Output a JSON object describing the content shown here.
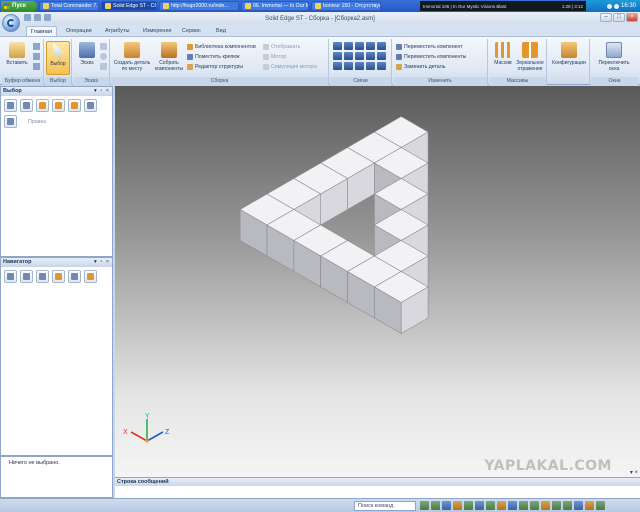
{
  "taskbar": {
    "start_label": "Пуск",
    "items": [
      {
        "label": "Total Commander 7.55 r...",
        "active": false
      },
      {
        "label": "Solid Edge ST - Сборк...",
        "active": true
      },
      {
        "label": "http://fsapr2000.ru/inde...",
        "active": false
      },
      {
        "label": "06. Immortal — In Our M...",
        "active": false
      },
      {
        "label": "bonivur 150 - Отсутствую",
        "active": false
      }
    ],
    "media_track": "Immortal 106 | In Our Mystic Visions Blast",
    "media_time": "1:28 | 3:12",
    "clock": "16:30"
  },
  "window": {
    "title": "Solid Edge ST - Сборка - [Сборка2.asm]",
    "controls": {
      "minimize": "–",
      "maximize": "□",
      "close": "×"
    }
  },
  "ribbon": {
    "tabs": [
      "Главная",
      "Операции",
      "Атрибуты",
      "Измерения",
      "Сервис",
      "Вид"
    ],
    "active_tab": 0,
    "groups": {
      "clipboard": {
        "label": "Буфер обмена",
        "paste": "Вставить"
      },
      "select": {
        "label": "Выбор",
        "select": "Выбор"
      },
      "sketch": {
        "label": "Эскиз",
        "sketch": "Эскиз"
      },
      "assembly": {
        "label": "Сборка",
        "create_in_place": "Создать деталь по месту",
        "assemble": "Собрать компоненты",
        "commands": [
          {
            "label": "Библиотека компонентов",
            "enabled": true
          },
          {
            "label": "Поместить крепеж",
            "enabled": true
          },
          {
            "label": "Редактор структуры",
            "enabled": true
          },
          {
            "label": "Отображать",
            "enabled": false
          },
          {
            "label": "Мотор",
            "enabled": false
          },
          {
            "label": "Симуляция мотора",
            "enabled": false
          }
        ]
      },
      "relations": {
        "label": "Связи"
      },
      "modify": {
        "label": "Изменить",
        "commands": [
          "Переместить компонент",
          "Переместить компоненты",
          "Заменить деталь"
        ]
      },
      "patterns": {
        "label": "Массивы",
        "pattern": "Массив",
        "mirror": "Зеркальное отражение"
      },
      "config": {
        "label": "Конфигурации"
      },
      "windows": {
        "label": "Окна",
        "switch": "Переключить окна"
      }
    }
  },
  "select_pane": {
    "title": "Выбор",
    "hint": "Правка"
  },
  "navigator_pane": {
    "title": "Навигатор",
    "status": "Ничего не выбрано."
  },
  "viewport": {
    "axes": {
      "x": "X",
      "y": "Y",
      "z": "Z"
    },
    "watermark": "YAPLAKAL.COM",
    "colors": {
      "cube_top": "#f2f2f4",
      "cube_left": "#b9b9c0",
      "cube_right": "#d8d8de"
    }
  },
  "message_bar": {
    "title": "Строка сообщений"
  },
  "bottombar": {
    "search_placeholder": "Поиск команд"
  }
}
